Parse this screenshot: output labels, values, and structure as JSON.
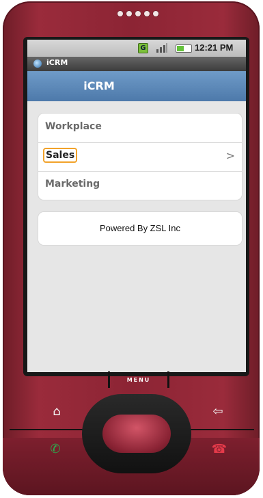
{
  "status_bar": {
    "time": "12:21 PM",
    "g_icon_text": "G"
  },
  "app": {
    "window_title": "iCRM",
    "header_title": "iCRM"
  },
  "menu": [
    {
      "label": "Workplace",
      "chevron": ""
    },
    {
      "label": "Sales",
      "chevron": ">"
    },
    {
      "label": "Marketing",
      "chevron": ""
    }
  ],
  "footer": {
    "text": "Powered By ZSL Inc"
  },
  "hardware": {
    "menu_key_label": "MENU",
    "home_icon": "⌂",
    "back_icon": "⇦",
    "call_icon": "✆",
    "end_icon": "☎"
  },
  "colors": {
    "phone_body": "#8c2434",
    "header_blue": "#5b88b9",
    "focus_orange": "#f2a229"
  }
}
